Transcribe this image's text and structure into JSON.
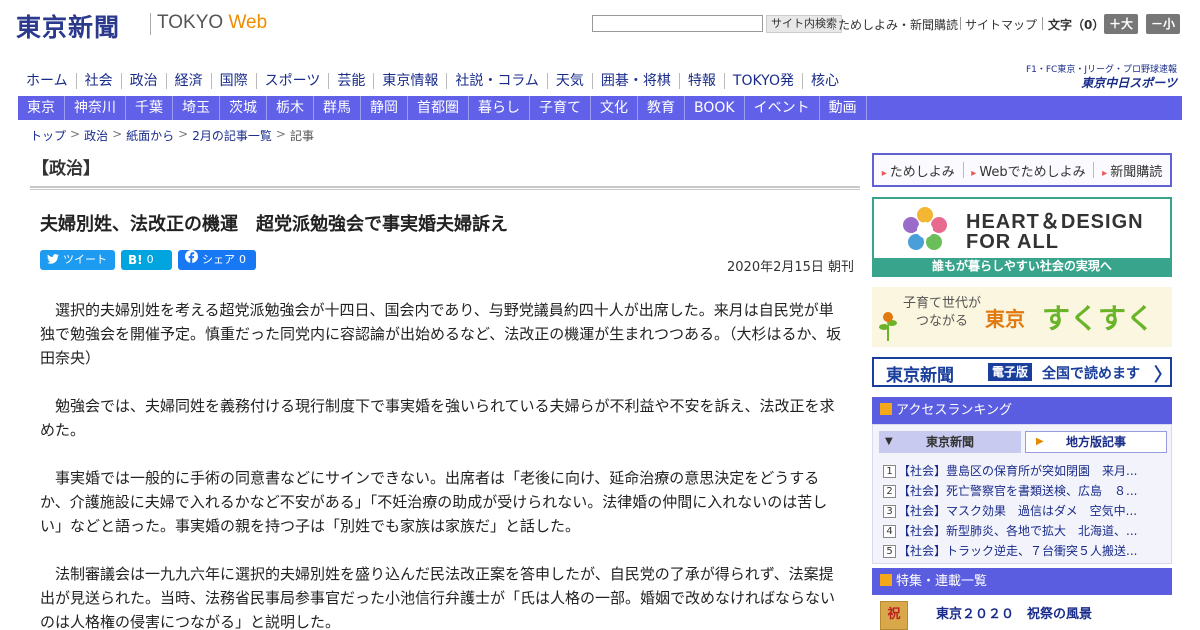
{
  "header": {
    "logo_jp": "東京新聞",
    "logo_en_prefix": "TOKYO ",
    "logo_en_suffix": "Web",
    "search_button": "サイト内検索",
    "links": [
      "ためしよみ・新聞購読",
      "サイトマップ"
    ],
    "fontsize_label": "文字（0）",
    "font_larger": "＋大",
    "font_smaller": "－小"
  },
  "main_nav": [
    "ホーム",
    "社会",
    "政治",
    "経済",
    "国際",
    "スポーツ",
    "芸能",
    "東京情報",
    "社説・コラム",
    "天気",
    "囲碁・将棋",
    "特報",
    "TOKYO発",
    "核心"
  ],
  "chunichi": {
    "line1": "F1・FC東京・Jリーグ・プロ野球速報",
    "line2": "東京中日スポーツ"
  },
  "region_nav": [
    "東京",
    "神奈川",
    "千葉",
    "埼玉",
    "茨城",
    "栃木",
    "群馬",
    "静岡",
    "首都圏",
    "暮らし",
    "子育て",
    "文化",
    "教育",
    "BOOK",
    "イベント",
    "動画"
  ],
  "breadcrumb": [
    "トップ",
    "政治",
    "紙面から",
    "2月の記事一覧",
    "記事"
  ],
  "section_title": "【政治】",
  "article": {
    "headline": "夫婦別姓、法改正の機運　超党派勉強会で事実婚夫婦訴え",
    "share": {
      "tweet": "ツイート",
      "hatena_count": "0",
      "fb_label": "シェア",
      "fb_count": "0"
    },
    "date": "2020年2月15日 朝刊",
    "paragraphs": [
      "選択的夫婦別姓を考える超党派勉強会が十四日、国会内であり、与野党議員約四十人が出席した。来月は自民党が単独で勉強会を開催予定。慎重だった同党内に容認論が出始めるなど、法改正の機運が生まれつつある。（大杉はるか、坂田奈央）",
      "勉強会では、夫婦同姓を義務付ける現行制度下で事実婚を強いられている夫婦らが不利益や不安を訴え、法改正を求めた。",
      "事実婚では一般的に手術の同意書などにサインできない。出席者は「老後に向け、延命治療の意思決定をどうするか、介護施設に夫婦で入れるかなど不安がある」「不妊治療の助成が受けられない。法律婚の仲間に入れないのは苦しい」などと語った。事実婚の親を持つ子は「別姓でも家族は家族だ」と話した。",
      "法制審議会は一九九六年に選択的夫婦別姓を盛り込んだ民法改正案を答申したが、自民党の了承が得られず、法案提出が見送られた。当時、法務省民事局参事官だった小池信行弁護士が「氏は人格の一部。婚姻で改めなければならないのは人格権の侵害につながる」と説明した。"
    ]
  },
  "sidebar": {
    "promo_links": [
      "ためしよみ",
      "Webでためしよみ",
      "新聞購読"
    ],
    "heart": {
      "line1": "HEART＆DESIGN",
      "line2": "FOR ALL",
      "caption": "誰もが暮らしやすい社会の実現へ"
    },
    "sukusuku": {
      "sub": "子育て世代がつながる",
      "t1": "東京",
      "t2": "すくすく"
    },
    "denshi": {
      "title": "東京新聞",
      "tag": "電子版",
      "text": "全国で読めます",
      "arrow": "〉"
    },
    "ranking": {
      "title": "アクセスランキング",
      "tab_active": "東京新聞",
      "tab_other": "地方版記事",
      "items": [
        {
          "n": "1",
          "text": "【社会】豊島区の保育所が突如閉園　来月..."
        },
        {
          "n": "2",
          "text": "【社会】死亡警察官を書類送検、広島　８..."
        },
        {
          "n": "3",
          "text": "【社会】マスク効果　過信はダメ　空気中..."
        },
        {
          "n": "4",
          "text": "【社会】新型肺炎、各地で拡大　北海道、..."
        },
        {
          "n": "5",
          "text": "【社会】トラック逆走、７台衝突５人搬送..."
        }
      ]
    },
    "tokushu": {
      "title": "特集・連載一覧",
      "thumb_text": "祝",
      "item": "東京２０２０　祝祭の風景"
    }
  }
}
